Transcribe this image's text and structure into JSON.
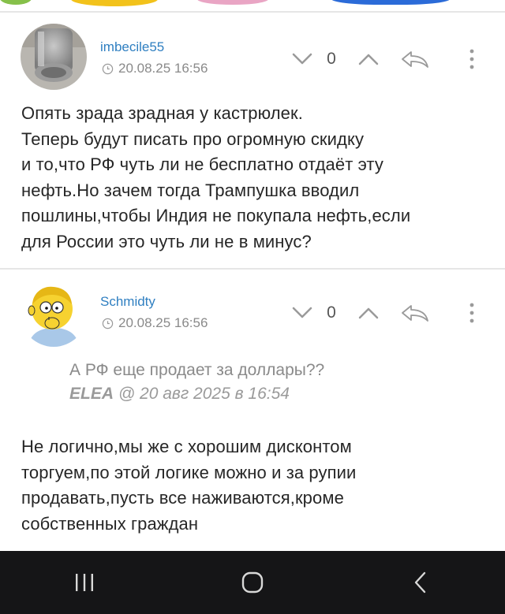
{
  "comments": [
    {
      "author": "imbecile55",
      "datetime": "20.08.25 16:56",
      "score": "0",
      "avatar_icon": "pipe-photo-avatar",
      "text": "Опять зрада зрадная у кастрюлек.\nТеперь будут писать про огромную скидку\nи то,что РФ чуть ли не бесплатно отдаёт эту\nнефть.Но зачем тогда Трампушка вводил\nпошлины,чтобы Индия не покупала нефть,если\nдля России это чуть ли не в минус?"
    },
    {
      "author": "Schmidty",
      "datetime": "20.08.25 16:56",
      "score": "0",
      "avatar_icon": "cartoon-kid-avatar",
      "quote": {
        "text": "А РФ еще продает за доллары??",
        "author": "ELEA",
        "at": "@ 20 авг 2025 в 16:54"
      },
      "text": "Не логично,мы же с хорошим дисконтом\nторгуем,по этой логике можно и за рупии\nпродавать,пусть все наживаются,кроме\nсобственных граждан"
    }
  ],
  "icons": {
    "downvote": "chevron-down-icon",
    "upvote": "chevron-up-icon",
    "reply": "reply-arrow-icon",
    "more": "more-vertical-icon",
    "clock": "clock-icon",
    "nav_recent": "recent-apps-icon",
    "nav_home": "home-icon",
    "nav_back": "back-icon"
  },
  "colors": {
    "author": "#2f7fc1",
    "meta": "#8a8a8a",
    "navbar": "#151517"
  }
}
